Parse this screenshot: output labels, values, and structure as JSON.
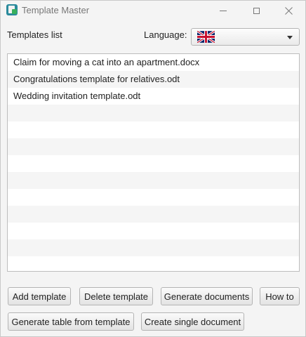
{
  "window": {
    "title": "Template Master",
    "icon": "template-master-app-icon"
  },
  "header": {
    "templates_label": "Templates list",
    "language_label": "Language:",
    "language_selected": "united-kingdom-flag"
  },
  "templates": [
    "Claim for moving a cat into an apartment.docx",
    "Congratulations template for relatives.odt",
    "Wedding invitation template.odt",
    "",
    "",
    "",
    "",
    "",
    "",
    "",
    "",
    "",
    ""
  ],
  "buttons": {
    "add": "Add template",
    "delete": "Delete template",
    "generate": "Generate documents",
    "howto": "How to",
    "table": "Generate table from template",
    "single": "Create single document"
  },
  "colors": {
    "app_icon": "#2a8a9c",
    "flag_blue": "#012169",
    "flag_red": "#C8102E",
    "row_stripe": "#f5f5f5"
  }
}
